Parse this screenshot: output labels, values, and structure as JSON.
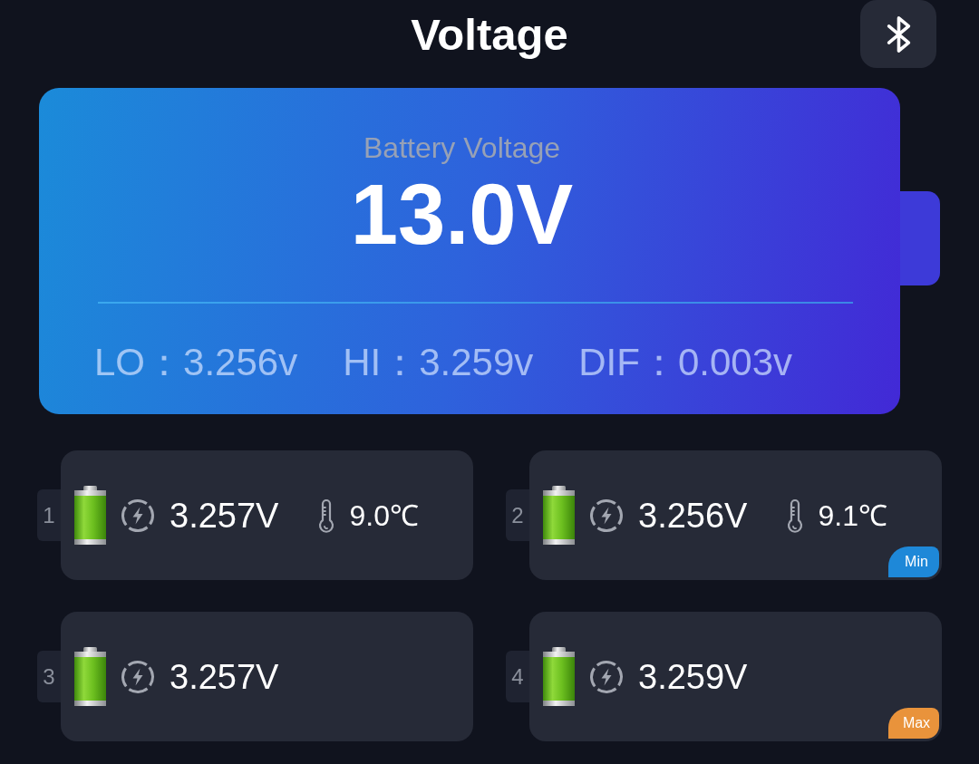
{
  "header": {
    "title": "Voltage"
  },
  "pack": {
    "label": "Battery Voltage",
    "value": "13.0V",
    "stats": [
      {
        "label": "LO：",
        "value": "3.256v"
      },
      {
        "label": "HI：",
        "value": "3.259v"
      },
      {
        "label": "DIF：",
        "value": "0.003v"
      }
    ]
  },
  "cells": [
    {
      "index": "1",
      "voltage": "3.257V",
      "temperature": "9.0℃"
    },
    {
      "index": "2",
      "voltage": "3.256V",
      "temperature": "9.1℃",
      "badge": {
        "label": "Min",
        "color": "#1e88d8"
      }
    },
    {
      "index": "3",
      "voltage": "3.257V"
    },
    {
      "index": "4",
      "voltage": "3.259V",
      "badge": {
        "label": "Max",
        "color": "#e9933b"
      }
    }
  ]
}
